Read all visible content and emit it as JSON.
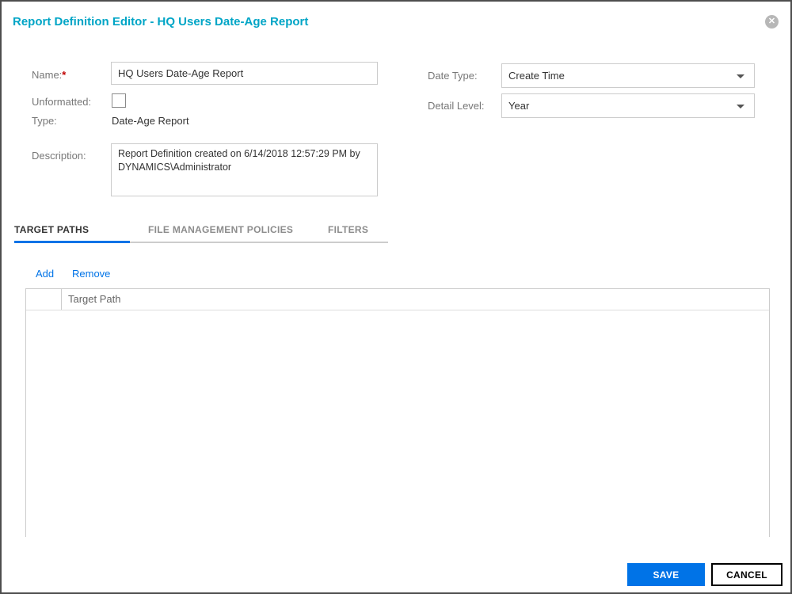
{
  "dialog": {
    "title": "Report Definition Editor - HQ Users Date-Age Report",
    "close_glyph": "✕"
  },
  "form": {
    "name_label": "Name:",
    "required_marker": "*",
    "name_value": "HQ Users Date-Age Report",
    "unformatted_label": "Unformatted:",
    "type_label": "Type:",
    "type_value": "Date-Age Report",
    "description_label": "Description:",
    "description_value": "Report Definition created on 6/14/2018 12:57:29 PM by DYNAMICS\\Administrator",
    "date_type_label": "Date Type:",
    "date_type_value": "Create Time",
    "detail_level_label": "Detail Level:",
    "detail_level_value": "Year"
  },
  "tabs": [
    {
      "label": "TARGET PATHS",
      "active": true
    },
    {
      "label": "FILE MANAGEMENT POLICIES",
      "active": false
    },
    {
      "label": "FILTERS",
      "active": false
    }
  ],
  "toolbar": {
    "add_label": "Add",
    "remove_label": "Remove"
  },
  "table": {
    "column_header": "Target Path",
    "rows": []
  },
  "footer": {
    "save_label": "SAVE",
    "cancel_label": "CANCEL"
  },
  "colors": {
    "title_teal": "#00a5c6",
    "accent_blue": "#0073e7",
    "label_gray": "#777777",
    "required_red": "#c00000"
  }
}
